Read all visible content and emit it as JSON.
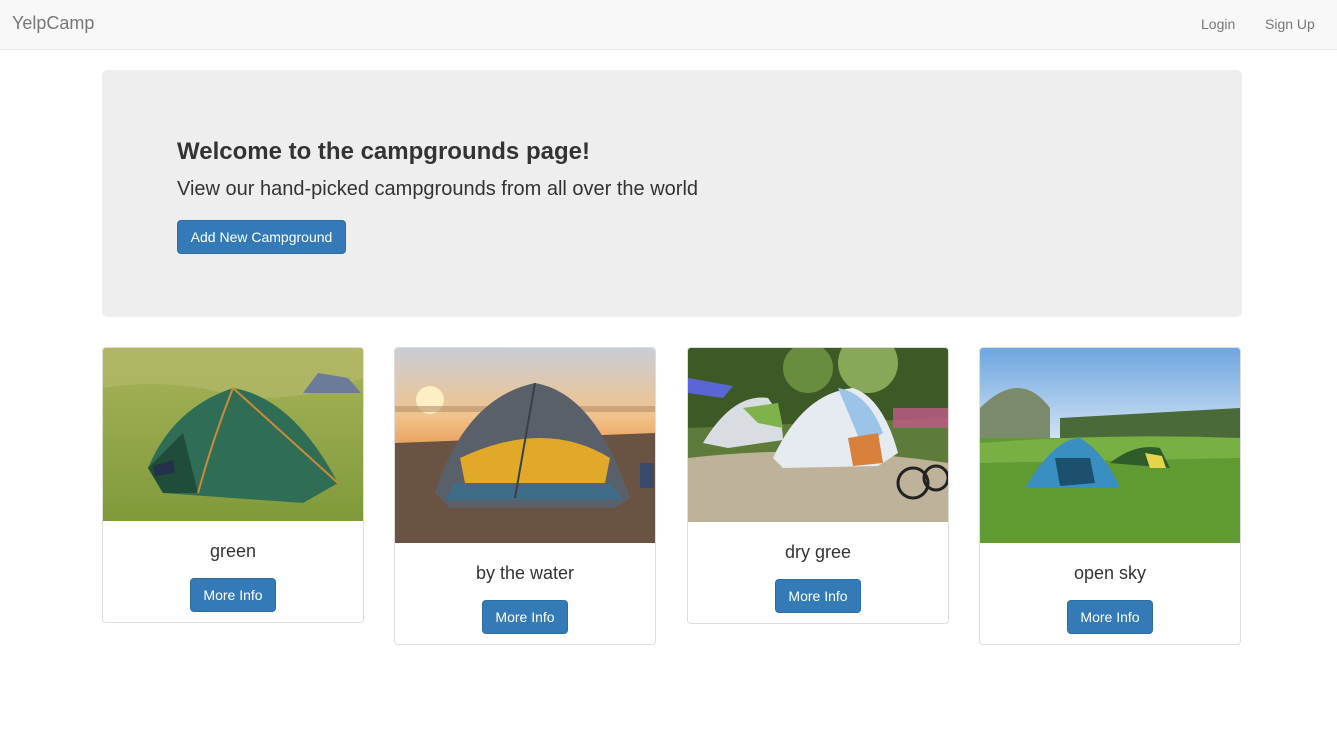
{
  "navbar": {
    "brand": "YelpCamp",
    "login": "Login",
    "signup": "Sign Up"
  },
  "jumbotron": {
    "title": "Welcome to the campgrounds page!",
    "lead": "View our hand-picked campgrounds from all over the world",
    "add_button": "Add New Campground"
  },
  "campgrounds": [
    {
      "name": "green",
      "button": "More Info"
    },
    {
      "name": "by the water",
      "button": "More Info"
    },
    {
      "name": "dry gree",
      "button": "More Info"
    },
    {
      "name": "open sky",
      "button": "More Info"
    }
  ],
  "colors": {
    "primary": "#337ab7",
    "navbar_bg": "#f8f8f8",
    "jumbotron_bg": "#eeeeee"
  }
}
